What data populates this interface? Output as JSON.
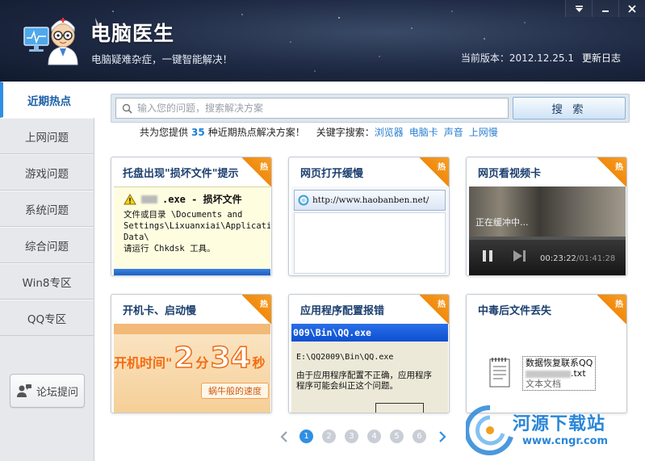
{
  "header": {
    "title": "电脑医生",
    "slogan": "电脑疑难杂症，一键智能解决！",
    "version_label": "当前版本：2012.12.25.1",
    "changelog_label": "更新日志"
  },
  "sidebar": {
    "items": [
      {
        "label": "近期热点",
        "active": true
      },
      {
        "label": "上网问题"
      },
      {
        "label": "游戏问题"
      },
      {
        "label": "系统问题"
      },
      {
        "label": "综合问题"
      },
      {
        "label": "Win8专区"
      },
      {
        "label": "QQ专区"
      }
    ],
    "forum_label": "论坛提问"
  },
  "search": {
    "placeholder": "输入您的问题，搜索解决方案",
    "value": "",
    "button_label": "搜 索"
  },
  "hot": {
    "prefix": "共为您提供",
    "count": "35",
    "suffix": "种近期热点解决方案！",
    "keywords_label": "关键字搜索：",
    "keywords": [
      "浏览器",
      "电脑卡",
      "声音",
      "上网慢"
    ]
  },
  "cards": [
    {
      "title": "托盘出现\"损坏文件\"提示",
      "badge": "热",
      "err_title": ".exe - 损坏文件",
      "err_body": "文件或目录 \\Documents and\nSettings\\Lixuanxiai\\Application\nData\\\n请运行 Chkdsk 工具。"
    },
    {
      "title": "网页打开缓慢",
      "badge": "热",
      "url": "http://www.haobanben.net/"
    },
    {
      "title": "网页看视频卡",
      "badge": "热",
      "buffer_text": "正在缓冲中...",
      "time_current": "00:23:22",
      "time_total": "/01:41:28"
    },
    {
      "title": "开机卡、启动慢",
      "badge": "热",
      "boot_label": "开机时间",
      "boot_num1": "2",
      "boot_unit1": "分",
      "boot_num2": "34",
      "boot_unit2": "秒",
      "speed_label": "蜗牛般的速度"
    },
    {
      "title": "应用程序配置报错",
      "badge": "热",
      "window_title": "009\\Bin\\QQ.exe",
      "path": "E:\\QQ2009\\Bin\\QQ.exe",
      "message": "由于应用程序配置不正确，应用程序\n程序可能会纠正这个问题。"
    },
    {
      "title": "中毒后文件丢失",
      "badge": "热",
      "file_line1": "数据恢复联系QQ",
      "file_ext": ".txt",
      "file_type": "文本文档"
    }
  ],
  "pager": {
    "pages": [
      "1",
      "2",
      "3",
      "4",
      "5",
      "6"
    ],
    "current": "1"
  },
  "watermark": {
    "name": "河源下载站",
    "url": "www.cngr.com"
  }
}
